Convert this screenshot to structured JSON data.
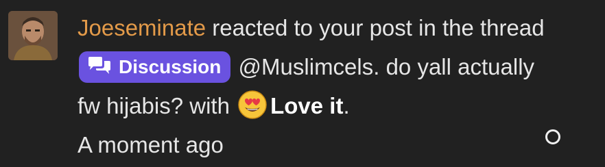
{
  "alert": {
    "username": "Joeseminate",
    "action_text": " reacted to your post in the thread ",
    "prefix_label": "Discussion",
    "thread_title": " @Muslimcels. do yall actually fw hijabis?",
    "with_text": " with ",
    "reaction_name": "Love it",
    "period": ".",
    "time": "A moment ago"
  },
  "colors": {
    "background": "#212121",
    "username": "#e39a49",
    "label_background": "#6a52e0",
    "text": "#e6e6e6"
  },
  "icons": {
    "label": "chat-bubbles-icon",
    "reaction": "heart-eyes-emoji-icon",
    "toggle": "mark-read-circle-icon"
  }
}
